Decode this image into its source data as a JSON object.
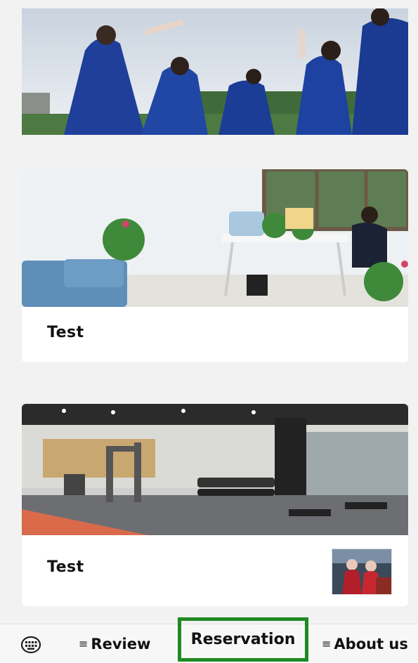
{
  "cards": [
    {
      "title": "",
      "photo": "graduates-celebrating-photo"
    },
    {
      "title": "Test",
      "photo": "office-photo"
    },
    {
      "title": "Test",
      "photo": "gym-photo",
      "thumbnail": "people-thumbnail"
    }
  ],
  "tabbar": {
    "keyboard_icon": "keyboard-icon",
    "menu_glyph": "≡",
    "review_label": "Review",
    "reservation_label": "Reservation",
    "about_label": "About us"
  },
  "colors": {
    "highlight": "#1e8a22",
    "background": "#f2f2f2"
  }
}
